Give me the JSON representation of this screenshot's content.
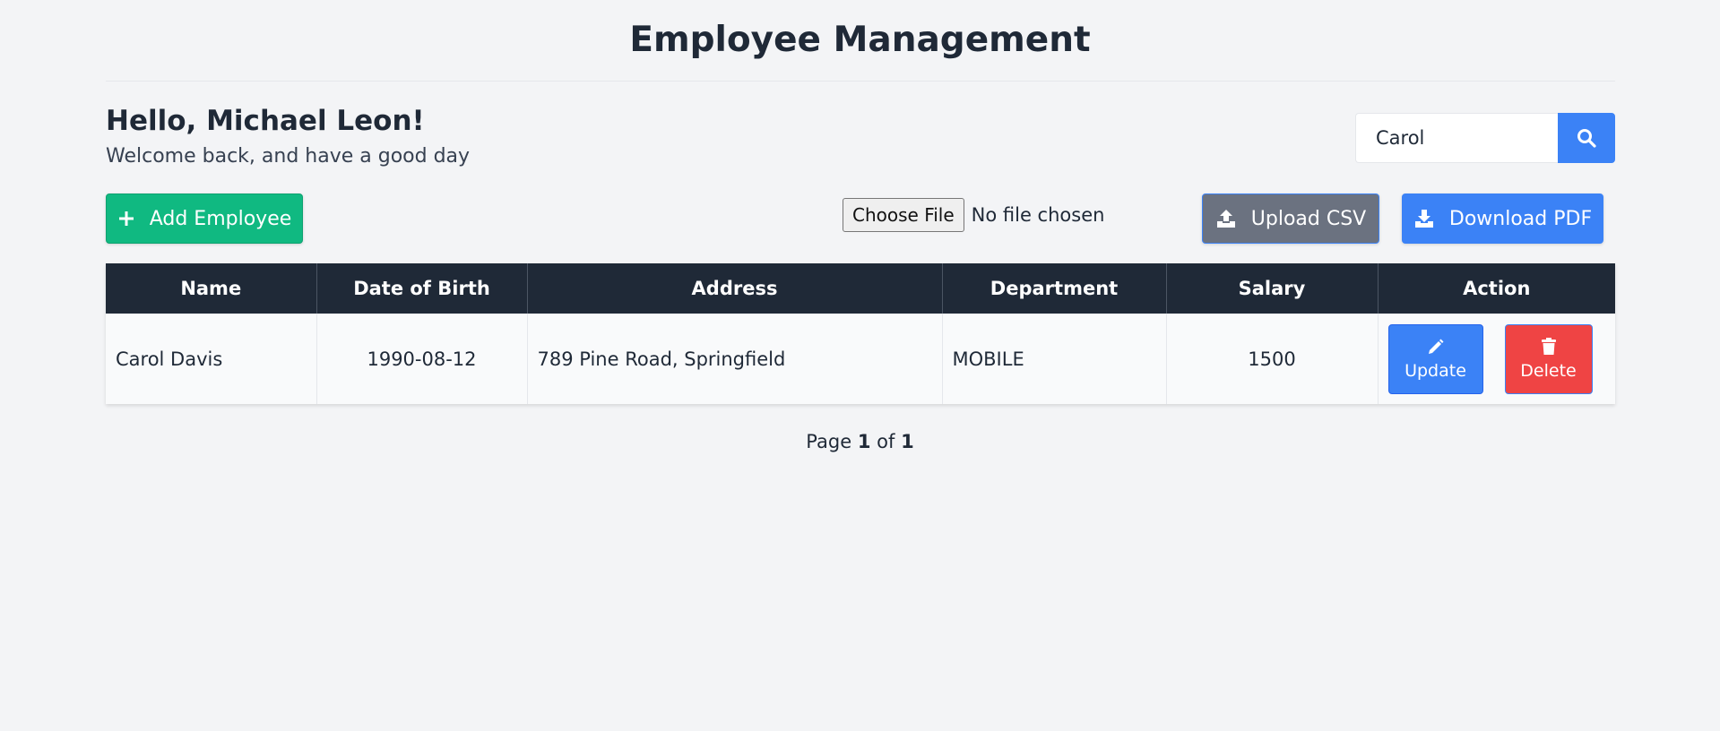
{
  "header": {
    "title": "Employee Management"
  },
  "user": {
    "greeting": "Hello, Michael Leon!",
    "welcome": "Welcome back, and have a good day"
  },
  "search": {
    "value": "Carol",
    "icon": "search-icon"
  },
  "toolbar": {
    "add_label": "Add Employee",
    "file_button_label": "Choose File",
    "file_status": "No file chosen",
    "upload_label": "Upload CSV",
    "download_label": "Download PDF"
  },
  "table": {
    "columns": [
      "Name",
      "Date of Birth",
      "Address",
      "Department",
      "Salary",
      "Action"
    ],
    "rows": [
      {
        "name": "Carol Davis",
        "dob": "1990-08-12",
        "address": "789 Pine Road, Springfield",
        "department": "MOBILE",
        "salary": "1500",
        "update_label": "Update",
        "delete_label": "Delete"
      }
    ]
  },
  "pagination": {
    "prefix": "Page",
    "current": "1",
    "separator": "of",
    "total": "1"
  },
  "colors": {
    "add": "#10b981",
    "upload": "#6b7280",
    "primary": "#3b82f6",
    "danger": "#ef4444",
    "header_bg": "#1f2937"
  }
}
